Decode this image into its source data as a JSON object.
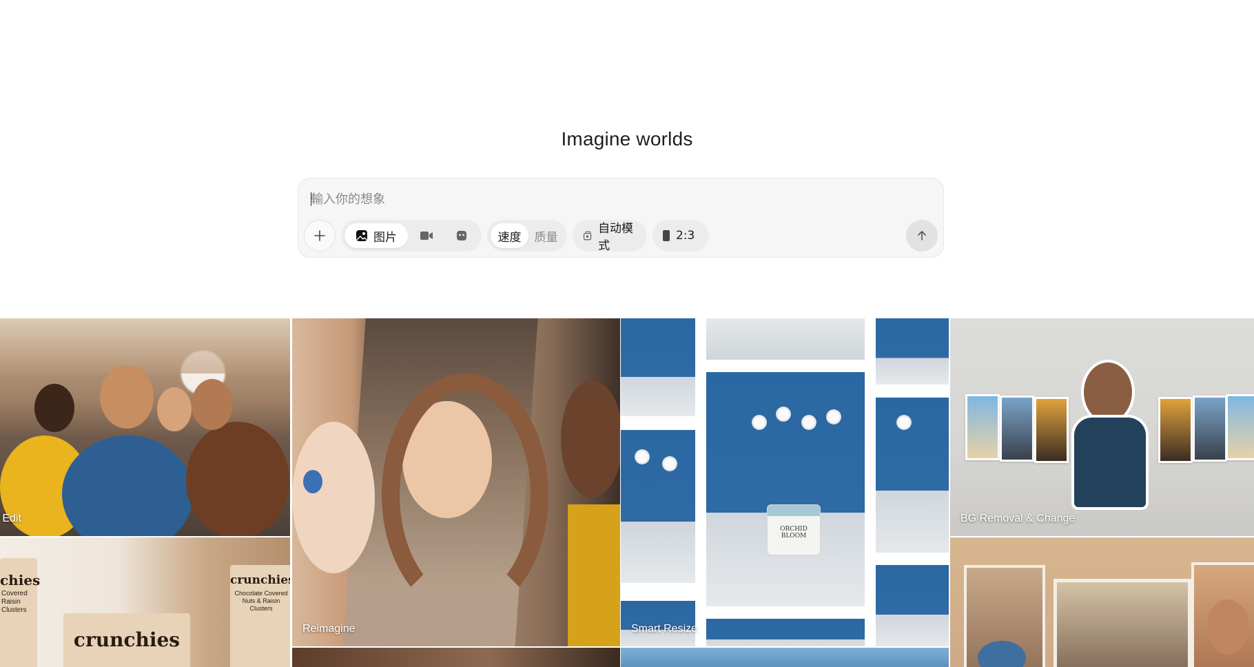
{
  "hero": {
    "title": "Imagine worlds"
  },
  "composer": {
    "placeholder": "輸入你的想象",
    "mode_tabs": [
      {
        "label": "图片",
        "icon": "image-icon",
        "active": true
      },
      {
        "label": "",
        "icon": "video-icon",
        "active": false
      },
      {
        "label": "",
        "icon": "character-icon",
        "active": false
      }
    ],
    "speed_tabs": [
      {
        "label": "速度",
        "active": true
      },
      {
        "label": "质量",
        "active": false
      }
    ],
    "auto_mode": {
      "label": "自动模式",
      "icon": "auto-mode-icon"
    },
    "aspect_ratio": {
      "label": "2:3",
      "icon": "portrait-ratio-icon"
    },
    "send": {
      "icon": "arrow-up-icon"
    }
  },
  "gallery": {
    "tiles": [
      {
        "label": "o Edit"
      },
      {
        "label": "Reimagine"
      },
      {
        "label": "Smart Resize"
      },
      {
        "label": "BG Removal & Change"
      },
      {
        "label": ""
      },
      {
        "label": ""
      }
    ],
    "product_text": {
      "bag_left": "chies",
      "bag_left_sub": "Covered\nRaisin\nClusters",
      "bag_center": "crunchies",
      "bag_right": "crunchies",
      "bag_right_sub": "Chocolate Covered Nuts & Raisin Clusters",
      "jar_brand": "ORCHID\nBLOOM"
    }
  }
}
